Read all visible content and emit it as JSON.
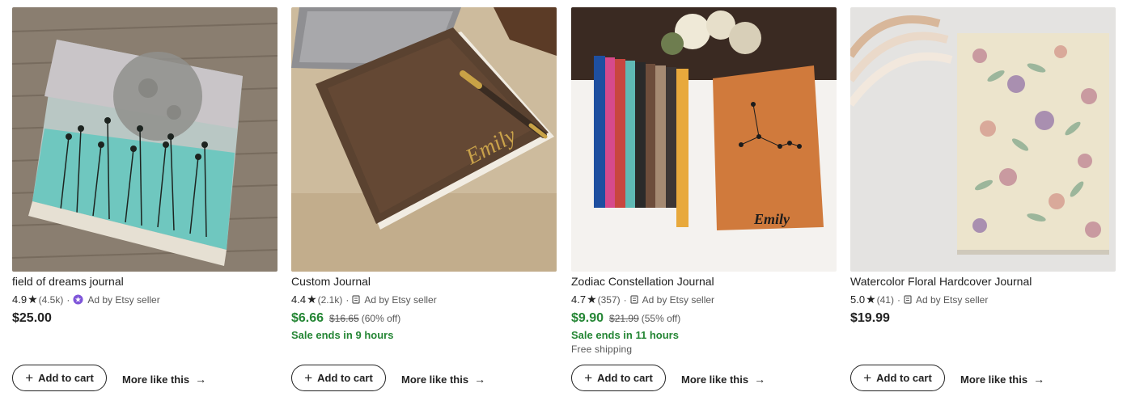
{
  "listings": [
    {
      "title": "field of dreams journal",
      "rating": "4.9",
      "reviews": "(4.5k)",
      "seller_badge": "Ad by Etsy seller",
      "price": "$25.00",
      "original_price": "",
      "discount": "",
      "sale_ends": "",
      "shipping": "",
      "add_to_cart": "Add to cart",
      "more_like_this": "More like this"
    },
    {
      "title": "Custom Journal",
      "rating": "4.4",
      "reviews": "(2.1k)",
      "seller_badge": "Ad by Etsy seller",
      "price": "$6.66",
      "original_price": "$16.65",
      "discount": "(60% off)",
      "sale_ends": "Sale ends in 9 hours",
      "shipping": "",
      "add_to_cart": "Add to cart",
      "more_like_this": "More like this"
    },
    {
      "title": "Zodiac Constellation Journal",
      "rating": "4.7",
      "reviews": "(357)",
      "seller_badge": "Ad by Etsy seller",
      "price": "$9.90",
      "original_price": "$21.99",
      "discount": "(55% off)",
      "sale_ends": "Sale ends in 11 hours",
      "shipping": "Free shipping",
      "add_to_cart": "Add to cart",
      "more_like_this": "More like this"
    },
    {
      "title": "Watercolor Floral Hardcover Journal",
      "rating": "5.0",
      "reviews": "(41)",
      "seller_badge": "Ad by Etsy seller",
      "price": "$19.99",
      "original_price": "",
      "discount": "",
      "sale_ends": "",
      "shipping": "",
      "add_to_cart": "Add to cart",
      "more_like_this": "More like this"
    }
  ],
  "image_texts": {
    "custom_journal_name": "Emily",
    "zodiac_journal_name": "Emily"
  },
  "colors": {
    "sale_green": "#258635",
    "star_seller_purple": "#7f56d9",
    "text_primary": "#222222",
    "text_secondary": "#595959"
  },
  "icons": [
    "star-icon",
    "star-seller-badge-icon",
    "ad-icon",
    "plus-icon",
    "arrow-right-icon"
  ]
}
